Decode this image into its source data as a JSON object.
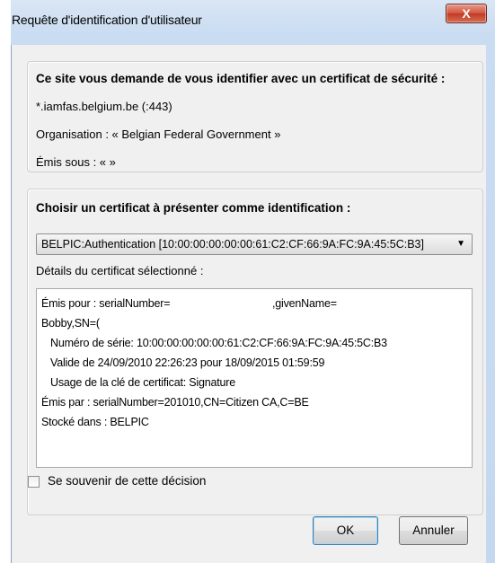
{
  "window": {
    "title": "Requête d'identification d'utilisateur",
    "close_label": "X"
  },
  "site_group": {
    "heading": "Ce site vous demande de vous identifier avec un certificat de sécurité :",
    "host": "*.iamfas.belgium.be (:443)",
    "organization": "Organisation : « Belgian Federal Government »",
    "issued_under": "Émis sous : «  »"
  },
  "cert_group": {
    "heading": "Choisir un certificat à présenter comme identification :",
    "selected_cert": "BELPIC:Authentication [10:00:00:00:00:00:61:C2:CF:66:9A:FC:9A:45:5C:B3]",
    "details_label": "Détails du certificat sélectionné :",
    "details": [
      "Émis pour : serialNumber=",
      ",givenName=",
      "Bobby,SN=(",
      "Numéro de série: 10:00:00:00:00:00:61:C2:CF:66:9A:FC:9A:45:5C:B3",
      "Valide de 24/09/2010 22:26:23 pour 18/09/2015 01:59:59",
      "Usage de la clé de certificat: Signature",
      "Émis par : serialNumber=201010,CN=Citizen CA,C=BE",
      "Stocké dans : BELPIC"
    ]
  },
  "remember": {
    "label": "Se souvenir de cette décision",
    "checked": false
  },
  "buttons": {
    "ok": "OK",
    "cancel": "Annuler"
  },
  "colors": {
    "titlebar": "#c9dcf1",
    "close_button": "#c9452e",
    "dialog_bg": "#f0f0f0",
    "ok_border": "#3c7fb1"
  }
}
